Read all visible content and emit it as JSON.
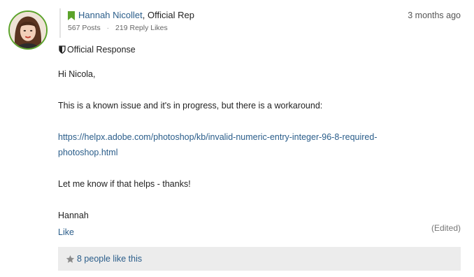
{
  "author": {
    "name": "Hannah Nicollet",
    "role": ", Official Rep",
    "posts": "567 Posts",
    "separator": "·",
    "reply_likes": "219 Reply Likes"
  },
  "post": {
    "timestamp": "3 months ago",
    "official_label": "Official Response",
    "lines": {
      "greeting": "Hi Nicola,",
      "issue": "This is a known issue and it's in progress, but there is a workaround:",
      "link_part1": "https://helpx.adobe.com/photoshop/kb/invalid-numeric-entry-integer-96-8-required-",
      "link_part2": "photoshop.html",
      "followup": "Let me know if that helps - thanks!",
      "signoff": "Hannah"
    },
    "like_label": "Like",
    "edited_label": "(Edited)",
    "likes_text": "8 people like this"
  },
  "colors": {
    "link": "#2a5d8a",
    "avatar_border": "#5ba32b",
    "likes_bar_bg": "#ececec"
  },
  "icons": {
    "author_badge": "bookmark-icon",
    "official": "shield-icon",
    "likes": "star-icon"
  }
}
